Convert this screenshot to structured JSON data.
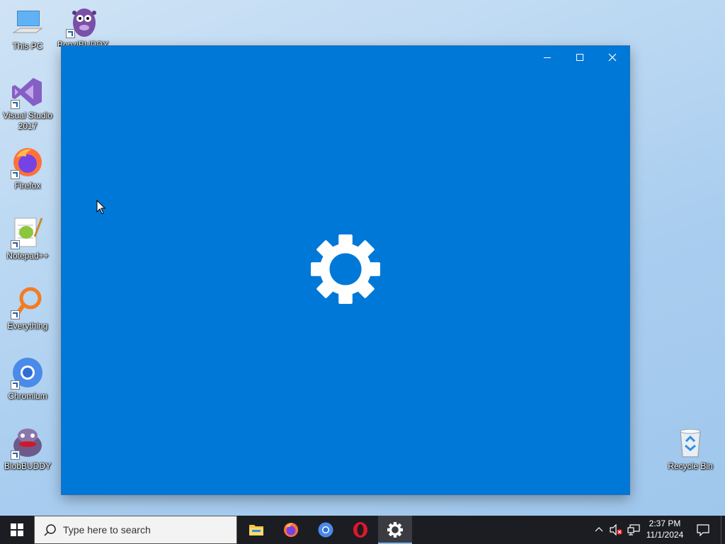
{
  "desktop": {
    "icons": [
      {
        "label": "This PC",
        "icon": "this-pc-icon"
      },
      {
        "label": "Visual Studio 2017",
        "icon": "visual-studio-icon"
      },
      {
        "label": "Firefox",
        "icon": "firefox-icon"
      },
      {
        "label": "Notepad++",
        "icon": "notepadpp-icon"
      },
      {
        "label": "Everything",
        "icon": "everything-icon"
      },
      {
        "label": "Chromium",
        "icon": "chromium-icon"
      },
      {
        "label": "BlobBUDDY",
        "icon": "blobbuddy-icon"
      },
      {
        "label": "Recycle Bin",
        "icon": "recycle-bin-icon"
      }
    ],
    "partial_icons": [
      {
        "label": "BonziBUDDY",
        "icon": "bonzibuddy-icon"
      }
    ]
  },
  "window": {
    "app": "Settings",
    "state": "loading splash",
    "background_color": "#0078d7",
    "controls": {
      "minimize": "minimize",
      "maximize": "maximize",
      "close": "close"
    },
    "splash_icon": "gear-icon"
  },
  "taskbar": {
    "search_placeholder": "Type here to search",
    "pinned_apps": [
      {
        "name": "File Explorer",
        "icon": "file-explorer-icon",
        "active": false
      },
      {
        "name": "Firefox",
        "icon": "firefox-icon",
        "active": false
      },
      {
        "name": "Chromium",
        "icon": "chromium-icon",
        "active": false
      },
      {
        "name": "Opera",
        "icon": "opera-icon",
        "active": false
      },
      {
        "name": "Settings",
        "icon": "gear-icon",
        "active": true
      }
    ],
    "tray": {
      "icons": [
        "chevron-up-icon",
        "volume-muted-icon",
        "network-icon",
        "notification-icon"
      ],
      "time": "2:37 PM",
      "date": "11/1/2024"
    }
  }
}
